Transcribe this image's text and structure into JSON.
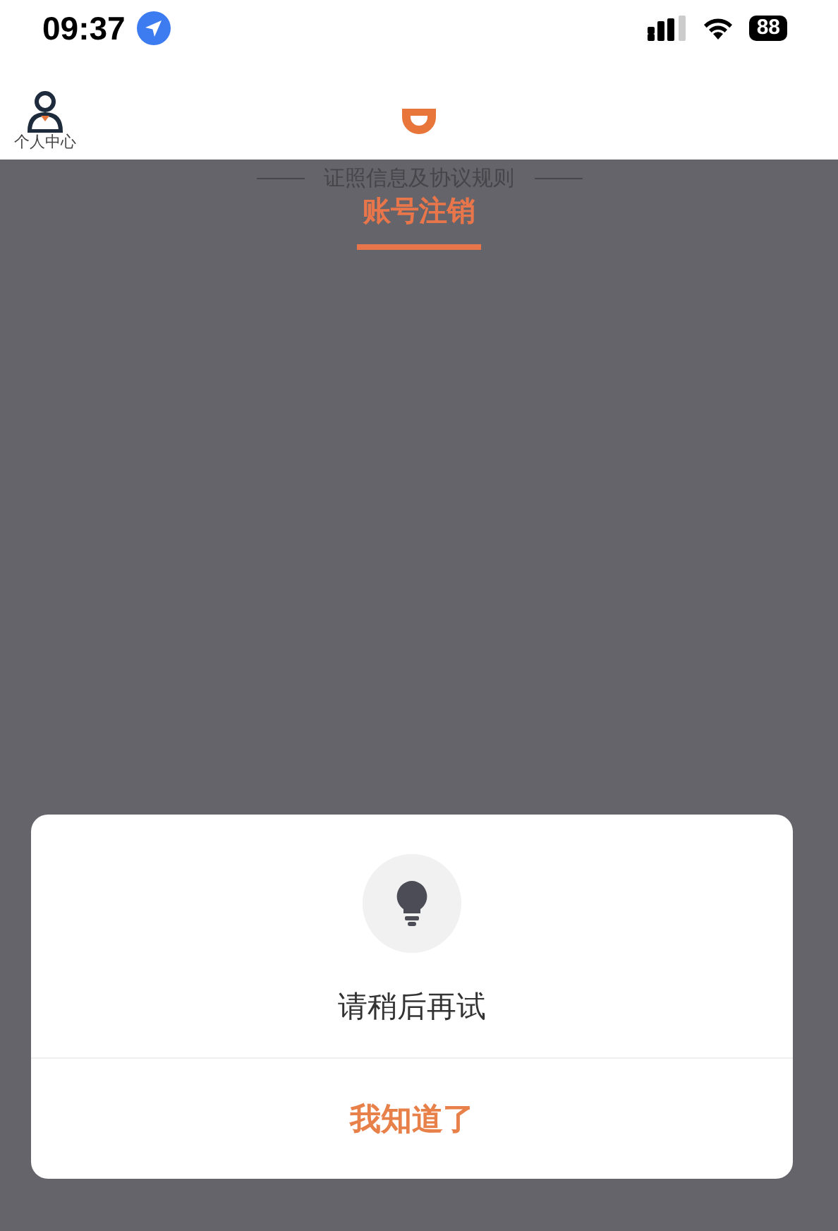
{
  "status_bar": {
    "time": "09:37",
    "battery": "88"
  },
  "header": {
    "profile_label": "个人中心"
  },
  "section": {
    "title": "证照信息及协议规则",
    "tabs": [
      {
        "label": "账号注销",
        "selected": true
      }
    ]
  },
  "dialog": {
    "message": "请稍后再试",
    "button": "我知道了"
  }
}
